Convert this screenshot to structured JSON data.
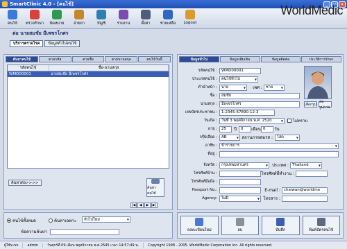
{
  "window": {
    "title": "SmartClinic 4.0 - [คนไข้]"
  },
  "brand": "WorldMedic",
  "toolbar": {
    "items": [
      {
        "label": "คนไข้",
        "icon": "patient-icon",
        "color": "#3b7ad9"
      },
      {
        "label": "ตรวจรักษา",
        "icon": "stethoscope-icon",
        "color": "#d9413b"
      },
      {
        "label": "นัดหมาย",
        "icon": "calendar-icon",
        "color": "#2d9a4f"
      },
      {
        "label": "จ่ายยา",
        "icon": "pill-icon",
        "color": "#c6862b"
      },
      {
        "label": "บัญชี",
        "icon": "money-icon",
        "color": "#2b7fb3"
      },
      {
        "label": "รายงาน",
        "icon": "chart-icon",
        "color": "#7a4bb3"
      },
      {
        "label": "ตั้งค่า",
        "icon": "settings-icon",
        "color": "#4e5d78"
      },
      {
        "label": "ช่วยเหลือ",
        "icon": "help-icon",
        "color": "#2f68c4"
      },
      {
        "label": "Logout",
        "icon": "lock-icon",
        "color": "#d99b2b"
      }
    ]
  },
  "page": {
    "header": "ต่อ นายสมชัย มีเพชรโกศร"
  },
  "top_tabs": [
    "บริการตรวจโรค",
    "ข้อมูลทั่วไปคนไข้"
  ],
  "left": {
    "subtabs": [
      "ค้นหาคนไข้",
      "ตามรหัส",
      "ตามชื่อ",
      "ตามนามสกุล",
      "คนไข้วันนี้"
    ],
    "grid": {
      "headers": [
        "รหัสคนไข้",
        "ชื่อ-นามสกุล"
      ],
      "rows": [
        {
          "id": "WMD00001",
          "name": "นายสมชัย มีเพชรโกศร"
        }
      ]
    },
    "search_more": "ค้นหาต่อ>>>>",
    "search_button": "ค้นหาคนไข้",
    "pager": [
      "|◀",
      "◀",
      "▶",
      "▶|"
    ],
    "lower": {
      "radio1": "คนไข้ทั้งหมด",
      "radio2": "ค้นหาเฉพาะ",
      "select_value": "ทั่วไปใหม่",
      "field_label": "ข้อความค้นหา"
    }
  },
  "right": {
    "subtabs": [
      "ข้อมูลทั่วไป",
      "ข้อมูลเพิ่มเติม",
      "ข้อมูลติดต่อ",
      "ประวัติการรักษา"
    ],
    "fields": {
      "patient_id_label": "รหัสคนไข้ :",
      "patient_id": "WMD00001",
      "type_label": "ประเภทคนไข้ :",
      "type": "คนไข้ทั่วไป",
      "prefix_label": "คำนำหน้า :",
      "prefix": "นาย",
      "sex_label": "เพศ :",
      "sex": "ชาย",
      "name_label": "ชื่อ :",
      "name": "สมชัย",
      "surname_label": "นามสกุล :",
      "surname": "มีเพชรโกศร",
      "citizen_id_label": "เลขบัตรประชาชน :",
      "citizen_id": "1-2345-67890-12-3",
      "birthdate_label": "วันเกิด :",
      "birthdate": "วันที่ 3 พฤศจิกายน พ.ศ. 2520",
      "unknown_label": "ไม่ทราบ",
      "age_label": "อายุ :",
      "age_years": "25",
      "age_months": "0",
      "age_days": "0",
      "blood_label": "กรุ๊ปเลือด :",
      "blood": "AB",
      "marital_label": "สถานภาพสมรส :",
      "marital": "โสด",
      "occupation_label": "อาชีพ :",
      "occupation": "ข้าราชการ",
      "address_label": "ที่อยู่ :",
      "address": "",
      "province_label": "จังหวัด :",
      "province": "กรุงเทพมหานคร",
      "country_label": "ประเทศ :",
      "country": "Thailand",
      "home_tel_label": "โทรศัพท์บ้าน :",
      "home_tel": "",
      "work_tel_label": "โทรศัพท์ที่ทำงาน :",
      "work_tel": "",
      "mobile_label": "โทรศัพท์มือถือ :",
      "mobile": "",
      "passport_label": "Passport No.:",
      "passport": "",
      "email_label": "E-mail :",
      "email": "chaiwan@worldme",
      "agency_label": "Agency:",
      "agency": "ไม่มี",
      "fax_label": "โทรสาร :",
      "fax": ""
    },
    "photo_buttons": [
      "เลือกรูป",
      "ลบรูปภาพ"
    ],
    "actions": [
      "ลงทะเบียนใหม่",
      "ลบ",
      "บันทึก",
      "พิมพ์บัตรคนไข้"
    ]
  },
  "status": {
    "user": "ผู้ใช้ระบบ",
    "username": "admin",
    "date": "วันศุกร์ที่ 09 เดือน พฤศจิกายน พ.ศ.2545 เวลา 14:57:49 น.",
    "copyright": "Copyright 1998 - 2005. WorldMedic Corporation Inc. All rights reserved."
  }
}
